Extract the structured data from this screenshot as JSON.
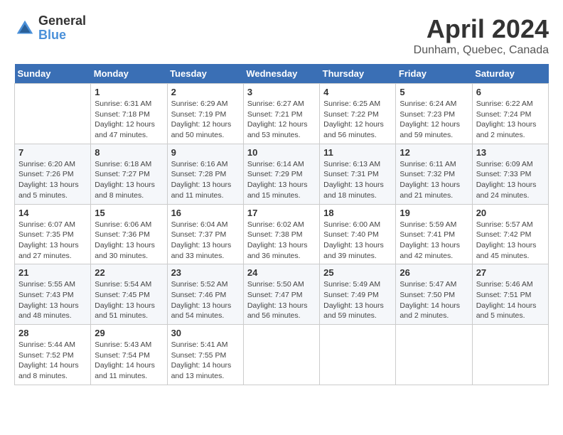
{
  "header": {
    "logo_line1": "General",
    "logo_line2": "Blue",
    "title": "April 2024",
    "subtitle": "Dunham, Quebec, Canada"
  },
  "weekdays": [
    "Sunday",
    "Monday",
    "Tuesday",
    "Wednesday",
    "Thursday",
    "Friday",
    "Saturday"
  ],
  "weeks": [
    [
      {
        "day": "",
        "sunrise": "",
        "sunset": "",
        "daylight": ""
      },
      {
        "day": "1",
        "sunrise": "Sunrise: 6:31 AM",
        "sunset": "Sunset: 7:18 PM",
        "daylight": "Daylight: 12 hours and 47 minutes."
      },
      {
        "day": "2",
        "sunrise": "Sunrise: 6:29 AM",
        "sunset": "Sunset: 7:19 PM",
        "daylight": "Daylight: 12 hours and 50 minutes."
      },
      {
        "day": "3",
        "sunrise": "Sunrise: 6:27 AM",
        "sunset": "Sunset: 7:21 PM",
        "daylight": "Daylight: 12 hours and 53 minutes."
      },
      {
        "day": "4",
        "sunrise": "Sunrise: 6:25 AM",
        "sunset": "Sunset: 7:22 PM",
        "daylight": "Daylight: 12 hours and 56 minutes."
      },
      {
        "day": "5",
        "sunrise": "Sunrise: 6:24 AM",
        "sunset": "Sunset: 7:23 PM",
        "daylight": "Daylight: 12 hours and 59 minutes."
      },
      {
        "day": "6",
        "sunrise": "Sunrise: 6:22 AM",
        "sunset": "Sunset: 7:24 PM",
        "daylight": "Daylight: 13 hours and 2 minutes."
      }
    ],
    [
      {
        "day": "7",
        "sunrise": "Sunrise: 6:20 AM",
        "sunset": "Sunset: 7:26 PM",
        "daylight": "Daylight: 13 hours and 5 minutes."
      },
      {
        "day": "8",
        "sunrise": "Sunrise: 6:18 AM",
        "sunset": "Sunset: 7:27 PM",
        "daylight": "Daylight: 13 hours and 8 minutes."
      },
      {
        "day": "9",
        "sunrise": "Sunrise: 6:16 AM",
        "sunset": "Sunset: 7:28 PM",
        "daylight": "Daylight: 13 hours and 11 minutes."
      },
      {
        "day": "10",
        "sunrise": "Sunrise: 6:14 AM",
        "sunset": "Sunset: 7:29 PM",
        "daylight": "Daylight: 13 hours and 15 minutes."
      },
      {
        "day": "11",
        "sunrise": "Sunrise: 6:13 AM",
        "sunset": "Sunset: 7:31 PM",
        "daylight": "Daylight: 13 hours and 18 minutes."
      },
      {
        "day": "12",
        "sunrise": "Sunrise: 6:11 AM",
        "sunset": "Sunset: 7:32 PM",
        "daylight": "Daylight: 13 hours and 21 minutes."
      },
      {
        "day": "13",
        "sunrise": "Sunrise: 6:09 AM",
        "sunset": "Sunset: 7:33 PM",
        "daylight": "Daylight: 13 hours and 24 minutes."
      }
    ],
    [
      {
        "day": "14",
        "sunrise": "Sunrise: 6:07 AM",
        "sunset": "Sunset: 7:35 PM",
        "daylight": "Daylight: 13 hours and 27 minutes."
      },
      {
        "day": "15",
        "sunrise": "Sunrise: 6:06 AM",
        "sunset": "Sunset: 7:36 PM",
        "daylight": "Daylight: 13 hours and 30 minutes."
      },
      {
        "day": "16",
        "sunrise": "Sunrise: 6:04 AM",
        "sunset": "Sunset: 7:37 PM",
        "daylight": "Daylight: 13 hours and 33 minutes."
      },
      {
        "day": "17",
        "sunrise": "Sunrise: 6:02 AM",
        "sunset": "Sunset: 7:38 PM",
        "daylight": "Daylight: 13 hours and 36 minutes."
      },
      {
        "day": "18",
        "sunrise": "Sunrise: 6:00 AM",
        "sunset": "Sunset: 7:40 PM",
        "daylight": "Daylight: 13 hours and 39 minutes."
      },
      {
        "day": "19",
        "sunrise": "Sunrise: 5:59 AM",
        "sunset": "Sunset: 7:41 PM",
        "daylight": "Daylight: 13 hours and 42 minutes."
      },
      {
        "day": "20",
        "sunrise": "Sunrise: 5:57 AM",
        "sunset": "Sunset: 7:42 PM",
        "daylight": "Daylight: 13 hours and 45 minutes."
      }
    ],
    [
      {
        "day": "21",
        "sunrise": "Sunrise: 5:55 AM",
        "sunset": "Sunset: 7:43 PM",
        "daylight": "Daylight: 13 hours and 48 minutes."
      },
      {
        "day": "22",
        "sunrise": "Sunrise: 5:54 AM",
        "sunset": "Sunset: 7:45 PM",
        "daylight": "Daylight: 13 hours and 51 minutes."
      },
      {
        "day": "23",
        "sunrise": "Sunrise: 5:52 AM",
        "sunset": "Sunset: 7:46 PM",
        "daylight": "Daylight: 13 hours and 54 minutes."
      },
      {
        "day": "24",
        "sunrise": "Sunrise: 5:50 AM",
        "sunset": "Sunset: 7:47 PM",
        "daylight": "Daylight: 13 hours and 56 minutes."
      },
      {
        "day": "25",
        "sunrise": "Sunrise: 5:49 AM",
        "sunset": "Sunset: 7:49 PM",
        "daylight": "Daylight: 13 hours and 59 minutes."
      },
      {
        "day": "26",
        "sunrise": "Sunrise: 5:47 AM",
        "sunset": "Sunset: 7:50 PM",
        "daylight": "Daylight: 14 hours and 2 minutes."
      },
      {
        "day": "27",
        "sunrise": "Sunrise: 5:46 AM",
        "sunset": "Sunset: 7:51 PM",
        "daylight": "Daylight: 14 hours and 5 minutes."
      }
    ],
    [
      {
        "day": "28",
        "sunrise": "Sunrise: 5:44 AM",
        "sunset": "Sunset: 7:52 PM",
        "daylight": "Daylight: 14 hours and 8 minutes."
      },
      {
        "day": "29",
        "sunrise": "Sunrise: 5:43 AM",
        "sunset": "Sunset: 7:54 PM",
        "daylight": "Daylight: 14 hours and 11 minutes."
      },
      {
        "day": "30",
        "sunrise": "Sunrise: 5:41 AM",
        "sunset": "Sunset: 7:55 PM",
        "daylight": "Daylight: 14 hours and 13 minutes."
      },
      {
        "day": "",
        "sunrise": "",
        "sunset": "",
        "daylight": ""
      },
      {
        "day": "",
        "sunrise": "",
        "sunset": "",
        "daylight": ""
      },
      {
        "day": "",
        "sunrise": "",
        "sunset": "",
        "daylight": ""
      },
      {
        "day": "",
        "sunrise": "",
        "sunset": "",
        "daylight": ""
      }
    ]
  ]
}
